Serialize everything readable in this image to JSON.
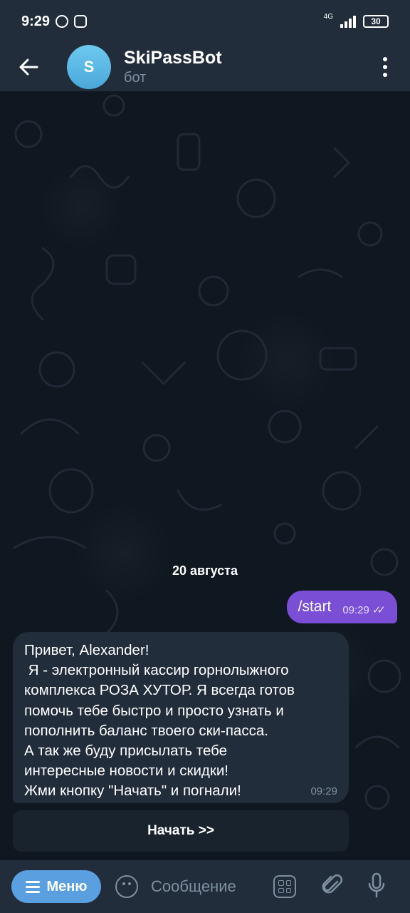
{
  "status_bar": {
    "time": "9:29",
    "network": "4G",
    "battery": "30"
  },
  "header": {
    "avatar_letter": "S",
    "title": "SkiPassBot",
    "subtitle": "бот"
  },
  "chat": {
    "date_separator": "20 августа",
    "outgoing": {
      "text": "/start",
      "time": "09:29"
    },
    "incoming": {
      "lines": [
        "Привет, Alexander!",
        " Я - электронный кассир горнолыжного",
        "комплекса РОЗА ХУТОР. Я всегда готов",
        "помочь тебе быстро и просто узнать и",
        "пополнить баланс твоего ски-пасса.",
        "А так же буду присылать тебе",
        "интересные новости и скидки!",
        "Жми кнопку \"Начать\" и погнали!"
      ],
      "time": "09:29"
    },
    "inline_button": "Начать >>"
  },
  "input_bar": {
    "menu_label": "Меню",
    "placeholder": "Сообщение"
  },
  "colors": {
    "header_bg": "#212d3b",
    "chat_bg": "#0f1720",
    "outgoing_bubble": "#7a4fd6",
    "incoming_bubble": "#212d3b",
    "menu_button": "#5a9fe0",
    "muted_text": "#7e8f9f"
  }
}
